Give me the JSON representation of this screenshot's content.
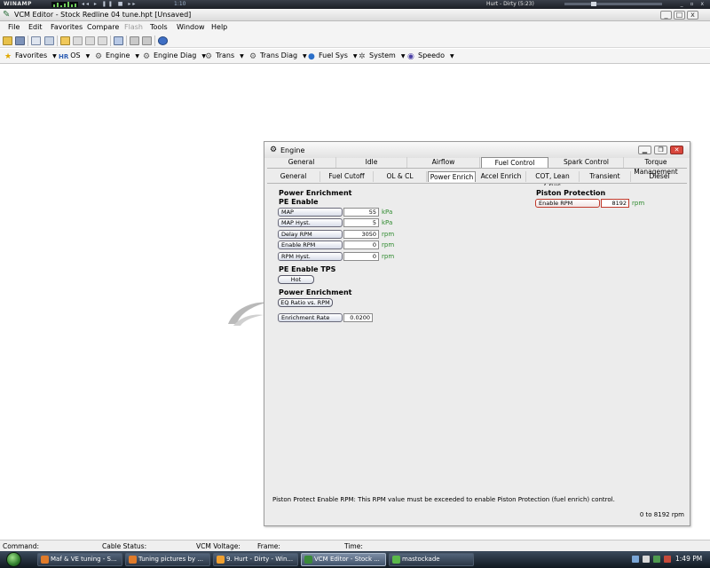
{
  "winamp": {
    "logo": "WINAMP",
    "buttons": "◂◂ ▸ ❚❚ ■ ▸▸",
    "time": "1:10",
    "song": "Hurt - Dirty (5:23)",
    "controls": "_ ▫ x"
  },
  "window": {
    "title": "VCM Editor - Stock Redline 04 tune.hpt   [Unsaved]",
    "min": "_",
    "max": "□",
    "close": "x"
  },
  "menu": {
    "items": [
      "File",
      "Edit",
      "Favorites",
      "Compare",
      "Flash",
      "Tools",
      "Window",
      "Help"
    ]
  },
  "nav": {
    "items": [
      {
        "label": "Favorites",
        "icon": "star-icon"
      },
      {
        "label": "OS",
        "icon": "os-icon"
      },
      {
        "label": "Engine",
        "icon": "engine-icon"
      },
      {
        "label": "Engine Diag",
        "icon": "engine-diag-icon"
      },
      {
        "label": "Trans",
        "icon": "trans-icon"
      },
      {
        "label": "Trans Diag",
        "icon": "trans-diag-icon"
      },
      {
        "label": "Fuel Sys",
        "icon": "fuel-icon"
      },
      {
        "label": "System",
        "icon": "system-icon"
      },
      {
        "label": "Speedo",
        "icon": "speedo-icon"
      }
    ],
    "os_prefix": "HR"
  },
  "engine_window": {
    "title": "Engine",
    "top_tabs": [
      "General",
      "Idle",
      "Airflow",
      "Fuel Control",
      "Spark Control",
      "Torque Management"
    ],
    "top_active": "Fuel Control",
    "sub_tabs": [
      "General",
      "Fuel Cutoff",
      "OL & CL",
      "Power Enrich",
      "Accel Enrich",
      "COT, Lean Cruis",
      "Transient",
      "Diesel"
    ],
    "sub_active": "Power Enrich",
    "power_enrichment": {
      "heading": "Power Enrichment",
      "pe_enable_heading": "PE Enable",
      "params": [
        {
          "label": "MAP",
          "value": "55",
          "unit": "kPa"
        },
        {
          "label": "MAP Hyst.",
          "value": "5",
          "unit": "kPa"
        },
        {
          "label": "Delay RPM",
          "value": "3050",
          "unit": "rpm"
        },
        {
          "label": "Enable RPM",
          "value": "0",
          "unit": "rpm"
        },
        {
          "label": "RPM Hyst.",
          "value": "0",
          "unit": "rpm"
        }
      ],
      "tps_heading": "PE Enable TPS",
      "tps_button": "Hot",
      "heading2": "Power Enrichment",
      "eq_button": "EQ Ratio vs. RPM",
      "enrichment_rate": {
        "label": "Enrichment Rate",
        "value": "0.0200"
      }
    },
    "piston_protection": {
      "heading": "Piston Protection",
      "enable_rpm": {
        "label": "Enable RPM",
        "value": "8192",
        "unit": "rpm"
      }
    },
    "status_text": "Piston Protect Enable RPM: This RPM value must be exceeded to enable Piston Protection (fuel enrich) control.",
    "range_text": "0 to 8192 rpm"
  },
  "statusbar": {
    "command": "Command:",
    "cable": "Cable Status:",
    "voltage": "VCM Voltage:",
    "frame": "Frame:",
    "time": "Time:"
  },
  "taskbar": {
    "items": [
      {
        "label": "Maf & VE tuning - S...",
        "active": false
      },
      {
        "label": "Tuning pictures by ...",
        "active": false
      },
      {
        "label": "9. Hurt - Dirty - Win...",
        "active": false
      },
      {
        "label": "VCM Editor - Stock ...",
        "active": true
      },
      {
        "label": "mastockade",
        "active": false
      }
    ],
    "clock": "1:49 PM"
  },
  "colors": {
    "unit_green": "#2d8a2d",
    "close_red": "#d8463c",
    "pp_border": "#c0392b"
  }
}
